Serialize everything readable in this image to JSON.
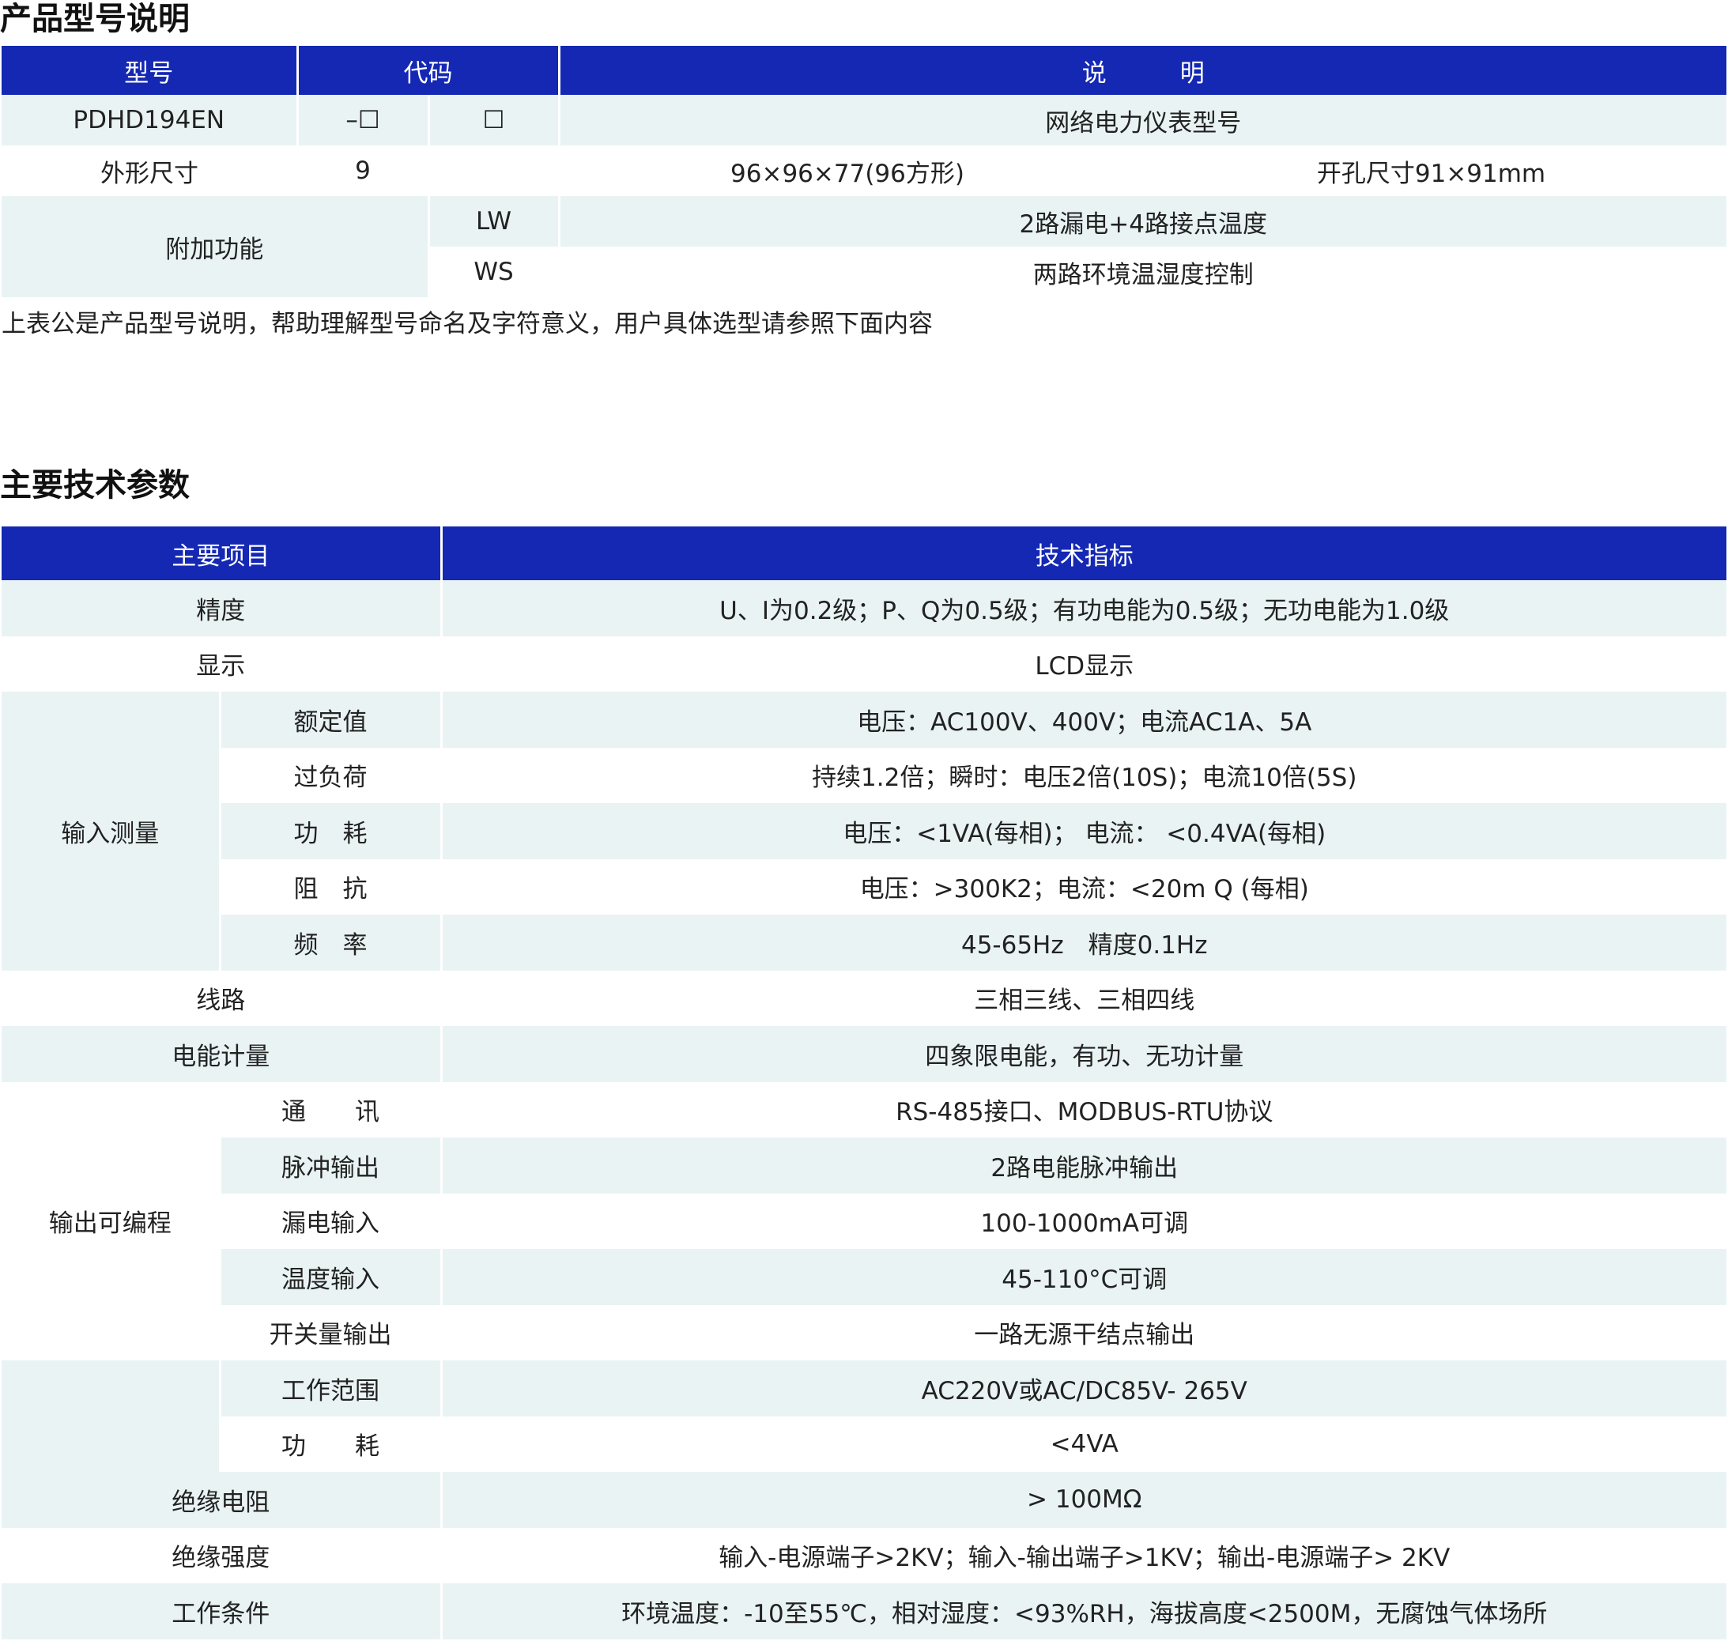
{
  "section1": {
    "title": "产品型号说明",
    "headers": {
      "model": "型号",
      "code": "代码",
      "desc": "说　　　明"
    },
    "row1": {
      "model": "PDHD194EN",
      "code1": "–☐",
      "code2": "☐",
      "desc": "网络电力仪表型号"
    },
    "row2": {
      "label": "外形尺寸",
      "code": "9",
      "size": "96×96×77(96方形)",
      "cutout": "开孔尺寸91×91mm"
    },
    "addon": {
      "label": "附加功能",
      "items": [
        {
          "code": "LW",
          "desc": "2路漏电+4路接点温度"
        },
        {
          "code": "WS",
          "desc": "两路环境温湿度控制"
        }
      ]
    },
    "note": "上表公是产品型号说明，帮助理解型号命名及字符意义，用户具体选型请参照下面内容"
  },
  "section2": {
    "title": "主要技术参数",
    "headers": {
      "item": "主要项目",
      "spec": "技术指标"
    },
    "rows": [
      {
        "item": "精度",
        "spec": "U、I为0.2级；P、Q为0.5级；有功电能为0.5级；无功电能为1.0级"
      },
      {
        "item": "显示",
        "spec": "LCD显示"
      },
      {
        "group": "输入测量",
        "sub": [
          {
            "item": "额定值",
            "spec": "电压：AC100V、400V；电流AC1A、5A"
          },
          {
            "item": "过负荷",
            "spec": "持续1.2倍；瞬时：电压2倍(10S)；电流10倍(5S)"
          },
          {
            "item": "功　耗",
            "spec": "电压：<1VA(每相)； 电流： <0.4VA(每相)"
          },
          {
            "item": "阻　抗",
            "spec": "电压：>300K2；电流：<20m Q (每相)"
          },
          {
            "item": "频　率",
            "spec": "45-65Hz　精度0.1Hz"
          }
        ]
      },
      {
        "item": "线路",
        "spec": "三相三线、三相四线"
      },
      {
        "item": "电能计量",
        "spec": "四象限电能，有功、无功计量"
      },
      {
        "group": "输出可编程",
        "sub": [
          {
            "item": "通　　讯",
            "spec": "RS-485接口、MODBUS-RTU协议"
          },
          {
            "item": "脉冲输出",
            "spec": "2路电能脉冲输出"
          },
          {
            "item": "漏电输入",
            "spec": "100-1000mA可调"
          },
          {
            "item": "温度输入",
            "spec": "45-110°C可调"
          },
          {
            "item": "开关量输出",
            "spec": "一路无源干结点输出"
          }
        ]
      },
      {
        "group": "",
        "sub": [
          {
            "item": "工作范围",
            "spec": "AC220V或AC/DC85V- 265V"
          },
          {
            "item": "功　　耗",
            "spec": "<4VA"
          }
        ]
      },
      {
        "item": "绝缘电阻",
        "spec": "> 100MΩ"
      },
      {
        "item": "绝缘强度",
        "spec": "输入-电源端子>2KV；输入-输出端子>1KV；输出-电源端子> 2KV"
      },
      {
        "item": "工作条件",
        "spec": "环境温度：-10至55℃，相对湿度：<93%RH，海拔高度<2500M，无腐蚀气体场所"
      }
    ]
  },
  "colors": {
    "header_bg": "#1428b4",
    "row_shade": "#e9f3f4",
    "header_text": "#ffffff"
  }
}
